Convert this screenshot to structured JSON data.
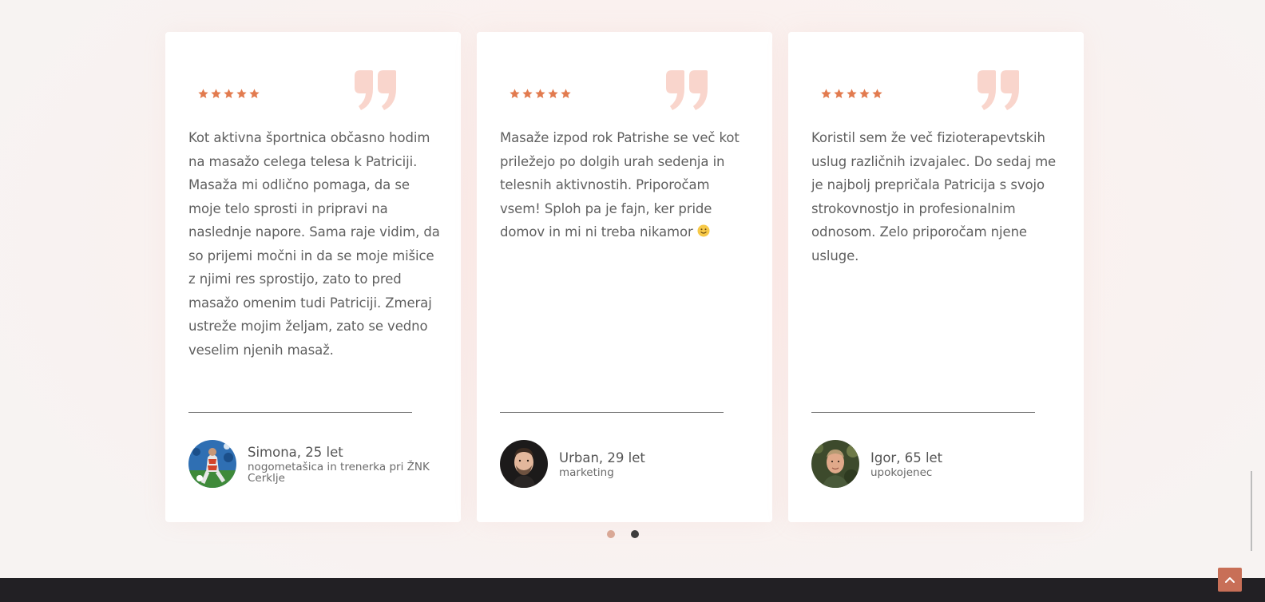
{
  "colors": {
    "accent": "#e27b4f",
    "quote": "#f9d5cc",
    "dot_active": "#d9a896",
    "dot_inactive": "#3d3d3d",
    "footer": "#222024",
    "scroll_button": "#c86f57"
  },
  "testimonials": [
    {
      "rating": 5,
      "icons": {
        "rating": "star-icon",
        "quote": "quote-icon"
      },
      "text": "Kot aktivna športnica občasno hodim na masažo celega telesa k Patriciji. Masaža mi odlično pomaga, da se moje telo sprosti in pripravi na naslednje napore. Sama raje vidim, da so prijemi močni in da se moje mišice z njimi res sprostijo, zato to pred masažo omenim tudi Patriciji. Zmeraj ustreže mojim željam, zato se vedno veselim njenih masaž.",
      "text_end": "",
      "name": "Simona, 25 let",
      "role": "nogometašica in trenerka pri ŽNK Cerklje"
    },
    {
      "rating": 5,
      "icons": {
        "rating": "star-icon",
        "quote": "quote-icon",
        "emoji": "smiley-face-icon"
      },
      "text": "Masaže izpod rok Patrishe se več kot priležejo po dolgih urah sedenja in telesnih aktivnostih. Priporočam vsem! Sploh pa je fajn, ker pride domov in mi ni treba nikamor",
      "text_end": " ",
      "name": "Urban, 29 let",
      "role": "marketing"
    },
    {
      "rating": 5,
      "icons": {
        "rating": "star-icon",
        "quote": "quote-icon"
      },
      "text": "Koristil sem že več fizioterapevtskih uslug različnih izvajalec. Do sedaj me je najbolj prepričala Patricija s svojo strokovnostjo in profesionalnim odnosom. Zelo priporočam njene usluge.",
      "text_end": "",
      "name": "Igor, 65 let",
      "role": "upokojenec"
    }
  ],
  "slider": {
    "page_count": 2,
    "active_index": 0
  },
  "controls": {
    "scroll_top_icon": "chevron-up-icon"
  }
}
